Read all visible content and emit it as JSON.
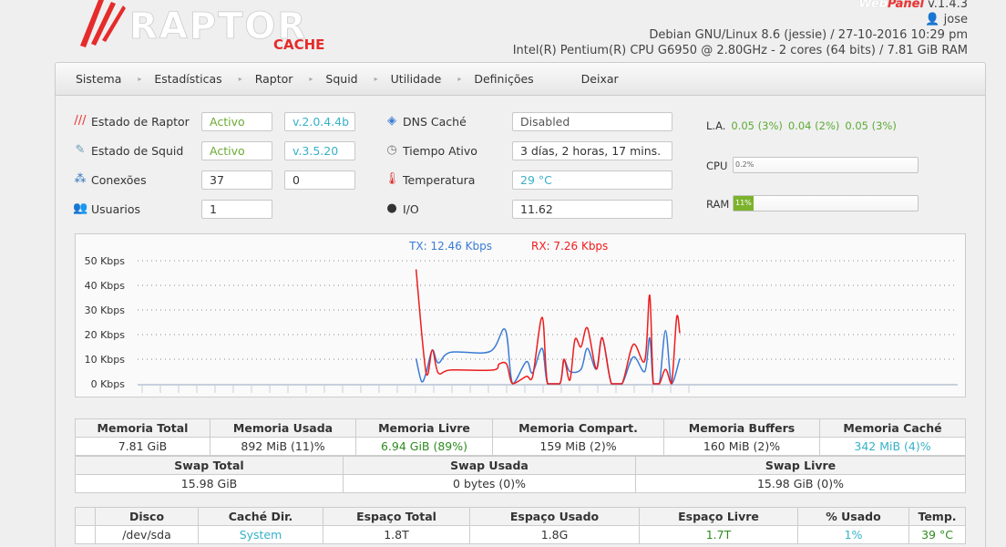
{
  "logo": {
    "text": "RAPTOR",
    "sub": "CACHE"
  },
  "header": {
    "webpanel_a": "Web",
    "webpanel_b": "Panel",
    "version": "v.1.4.3",
    "user": "jose",
    "os_line": "Debian GNU/Linux 8.6 (jessie) / 27-10-2016 10:29 pm",
    "cpu_line": "Intel(R) Pentium(R) CPU G6950 @ 2.80GHz - 2 cores (64 bits)  / 7.81 GiB RAM"
  },
  "nav": [
    "Sistema",
    "Estadísticas",
    "Raptor",
    "Squid",
    "Utilidade",
    "Definições",
    "Deixar"
  ],
  "status": {
    "raptor": {
      "label": "Estado de Raptor",
      "state": "Activo",
      "version": "v.2.0.4.4b"
    },
    "squid": {
      "label": "Estado de Squid",
      "state": "Activo",
      "version": "v.3.5.20"
    },
    "conn": {
      "label": "Conexões",
      "v1": "37",
      "v2": "0"
    },
    "users": {
      "label": "Usuarios",
      "v1": "1"
    },
    "dns": {
      "label": "DNS Caché",
      "value": "Disabled"
    },
    "uptime": {
      "label": "Tiempo Ativo",
      "value": "3 días, 2 horas, 17 mins."
    },
    "temp": {
      "label": "Temperatura",
      "value": "29 °C"
    },
    "io": {
      "label": "I/O",
      "value": "11.62"
    }
  },
  "load": {
    "label": "L.A.",
    "values": [
      "0.05 (3%)",
      "0.04 (2%)",
      "0.05 (3%)"
    ]
  },
  "cpu": {
    "label": "CPU",
    "text": "0.2%",
    "percent": 0.2
  },
  "ram": {
    "label": "RAM",
    "text": "11%",
    "percent": 11
  },
  "chart_data": {
    "type": "line",
    "legend": {
      "tx": "TX: 12.46 Kbps",
      "rx": "RX: 7.26 Kbps"
    },
    "yticks": [
      "0 Kbps",
      "10 Kbps",
      "20 Kbps",
      "30 Kbps",
      "40 Kbps",
      "50 Kbps"
    ],
    "ylim": [
      0,
      50
    ],
    "xlim": [
      0,
      45
    ],
    "colors": {
      "tx": "#3a7bd5",
      "rx": "#ee1c1c"
    },
    "series": [
      {
        "name": "TX",
        "x": [
          15.28,
          15.58,
          15.83,
          16.17,
          16.5,
          17.17,
          19.33,
          20.17,
          20.58,
          21.33,
          21.67,
          22.2,
          22.5,
          23.17,
          23.4,
          23.72,
          24.33,
          24.68,
          25.17,
          25.5,
          26,
          26.58,
          27.2,
          27.83,
          28.1,
          28.3,
          28.63,
          28.97,
          29.3,
          29.75
        ],
        "y": [
          10.3,
          1,
          4.4,
          13.7,
          8.5,
          12.8,
          13.1,
          22,
          0,
          9,
          4.4,
          14.4,
          0,
          0,
          9.4,
          5,
          5.9,
          14.4,
          6,
          18.7,
          0,
          0,
          10.9,
          5,
          18.7,
          0,
          0,
          21.6,
          0,
          10.3
        ]
      },
      {
        "name": "RX",
        "x": [
          15.28,
          15.83,
          16.17,
          16.5,
          17.17,
          19.5,
          19.83,
          20.25,
          20.58,
          21.33,
          21.67,
          22.2,
          22.5,
          23.17,
          23.4,
          23.72,
          24,
          24.33,
          24.68,
          25.17,
          25.5,
          26,
          26.58,
          27.2,
          27.83,
          28.1,
          28.3,
          28.63,
          28.97,
          29.3,
          29.58,
          29.75
        ],
        "y": [
          46.5,
          4.4,
          13.7,
          4.4,
          5.6,
          5.6,
          8,
          8,
          0,
          3,
          2.7,
          27,
          0,
          0,
          10,
          1.5,
          18,
          15,
          22.7,
          6,
          18.7,
          0,
          0,
          16,
          9.4,
          36,
          0,
          0,
          5.9,
          0,
          27,
          20.6
        ]
      }
    ]
  },
  "memory": {
    "headers": [
      "Memoria Total",
      "Memoria Usada",
      "Memoria Livre",
      "Memoria Compart.",
      "Memoria Buffers",
      "Memoria Caché"
    ],
    "values": [
      "7.81 GiB",
      "892 MiB (11)%",
      "6.94 GiB (89%)",
      "159 MiB (2)%",
      "160 MiB (2)%",
      "342 MiB (4)%"
    ],
    "swap_headers": [
      "Swap Total",
      "Swap Usada",
      "Swap Livre"
    ],
    "swap_values": [
      "15.98 GiB",
      "0 bytes (0)%",
      "15.98 GiB (0)%"
    ]
  },
  "disk": {
    "headers": [
      "Disco",
      "Caché Dir.",
      "Espaço Total",
      "Espaço Usado",
      "Espaço Livre",
      "% Usado",
      "Temp."
    ],
    "values": [
      "/dev/sda",
      "System",
      "1.8T",
      "1.8G",
      "1.7T",
      "1%",
      "39 °C"
    ]
  }
}
